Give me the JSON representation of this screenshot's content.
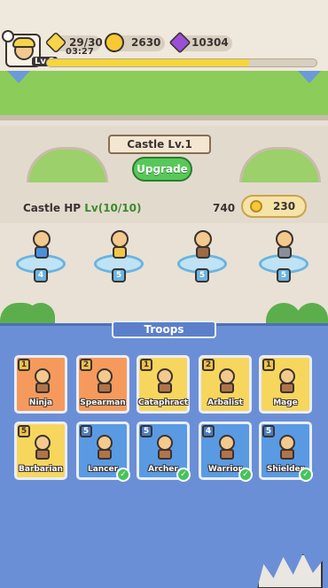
{
  "hud": {
    "level": "Lv.3",
    "energy": "29/30",
    "energy_timer": "03:27",
    "coins": "2630",
    "gems": "10304",
    "xp_progress": 0.75
  },
  "castle": {
    "name": "Castle Lv.1",
    "upgrade_label": "Upgrade",
    "hp_label": "Castle HP",
    "hp_level": "Lv(10/10)",
    "hp_value": "740",
    "upgrade_cost": "230"
  },
  "deployed": [
    {
      "level": "4",
      "body_color": "#4c8fdc"
    },
    {
      "level": "5",
      "body_color": "#f0c64a"
    },
    {
      "level": "5",
      "body_color": "#9a6b45"
    },
    {
      "level": "5",
      "body_color": "#8a8e98"
    }
  ],
  "troops": {
    "title": "Troops",
    "cards": [
      {
        "name": "Ninja",
        "level": "1",
        "style": "orange",
        "selected": false
      },
      {
        "name": "Spearman",
        "level": "2",
        "style": "orange",
        "selected": false
      },
      {
        "name": "Cataphract",
        "level": "1",
        "style": "yellow",
        "selected": false
      },
      {
        "name": "Arbalist",
        "level": "2",
        "style": "yellow",
        "selected": false
      },
      {
        "name": "Mage",
        "level": "1",
        "style": "yellow",
        "selected": false
      },
      {
        "name": "Barbarian",
        "level": "5",
        "style": "yellow",
        "selected": false
      },
      {
        "name": "Lancer",
        "level": "5",
        "style": "blue",
        "selected": true
      },
      {
        "name": "Archer",
        "level": "5",
        "style": "blue",
        "selected": true
      },
      {
        "name": "Warrior",
        "level": "4",
        "style": "blue",
        "selected": true
      },
      {
        "name": "Shielder",
        "level": "5",
        "style": "blue",
        "selected": true
      }
    ]
  }
}
